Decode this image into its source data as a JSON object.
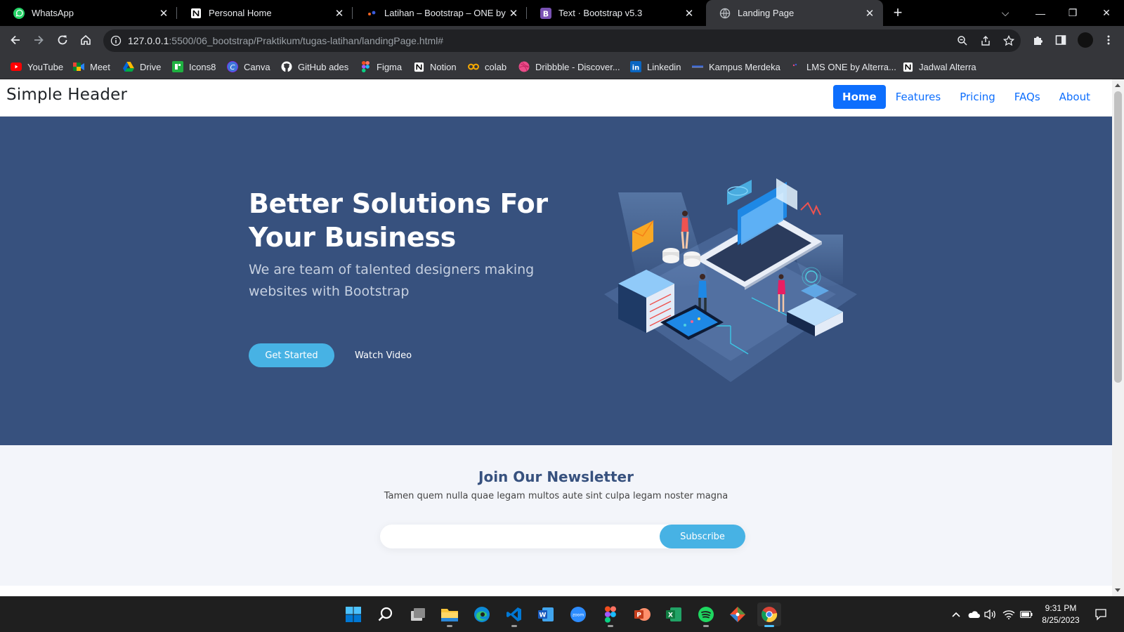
{
  "browser": {
    "tabs": [
      {
        "title": "WhatsApp",
        "icon": "whatsapp-icon",
        "active": false
      },
      {
        "title": "Personal Home",
        "icon": "notion-icon",
        "active": false
      },
      {
        "title": "Latihan – Bootstrap – ONE by Alt",
        "icon": "alterra-icon",
        "active": false
      },
      {
        "title": "Text · Bootstrap v5.3",
        "icon": "bootstrap-icon",
        "active": false
      },
      {
        "title": "Landing Page",
        "icon": "globe-icon",
        "active": true
      }
    ],
    "url_host": "127.0.0.1",
    "url_path": ":5500/06_bootstrap/Praktikum/tugas-latihan/landingPage.html#"
  },
  "bookmarks": [
    {
      "label": "YouTube",
      "icon": "youtube-icon"
    },
    {
      "label": "Meet",
      "icon": "meet-icon"
    },
    {
      "label": "Drive",
      "icon": "drive-icon"
    },
    {
      "label": "Icons8",
      "icon": "icons8-icon"
    },
    {
      "label": "Canva",
      "icon": "canva-icon"
    },
    {
      "label": "GitHub ades",
      "icon": "github-icon"
    },
    {
      "label": "Figma",
      "icon": "figma-icon"
    },
    {
      "label": "Notion",
      "icon": "notion-icon"
    },
    {
      "label": "colab",
      "icon": "colab-icon"
    },
    {
      "label": "Dribbble - Discover...",
      "icon": "dribbble-icon"
    },
    {
      "label": "Linkedin",
      "icon": "linkedin-icon"
    },
    {
      "label": "Kampus Merdeka",
      "icon": "kampus-merdeka-icon"
    },
    {
      "label": "LMS ONE by Alterra...",
      "icon": "alterra-icon"
    },
    {
      "label": "Jadwal Alterra",
      "icon": "notion-icon"
    }
  ],
  "site": {
    "brand": "Simple Header",
    "nav": [
      {
        "label": "Home",
        "active": true
      },
      {
        "label": "Features",
        "active": false
      },
      {
        "label": "Pricing",
        "active": false
      },
      {
        "label": "FAQs",
        "active": false
      },
      {
        "label": "About",
        "active": false
      }
    ],
    "hero": {
      "title": "Better Solutions For Your Business",
      "subtitle": "We are team of talented designers making websites with Bootstrap",
      "cta_primary": "Get Started",
      "cta_secondary": "Watch Video"
    },
    "newsletter": {
      "title": "Join Our Newsletter",
      "text": "Tamen quem nulla quae legam multos aute sint culpa legam noster magna",
      "input_value": "",
      "button": "Subscribe"
    }
  },
  "taskbar": {
    "time": "9:31 PM",
    "date": "8/25/2023",
    "apps": [
      "windows-start-icon",
      "search-icon",
      "task-view-icon",
      "file-explorer-icon",
      "edge-icon",
      "vscode-icon",
      "word-icon",
      "zoom-icon",
      "figma-icon",
      "powerpoint-icon",
      "excel-icon",
      "spotify-icon",
      "git-icon",
      "chrome-icon"
    ]
  },
  "colors": {
    "hero_bg": "#37517e",
    "accent": "#47b2e4",
    "nav_active": "#0d6efd",
    "newsletter_bg": "#f3f5fa"
  }
}
